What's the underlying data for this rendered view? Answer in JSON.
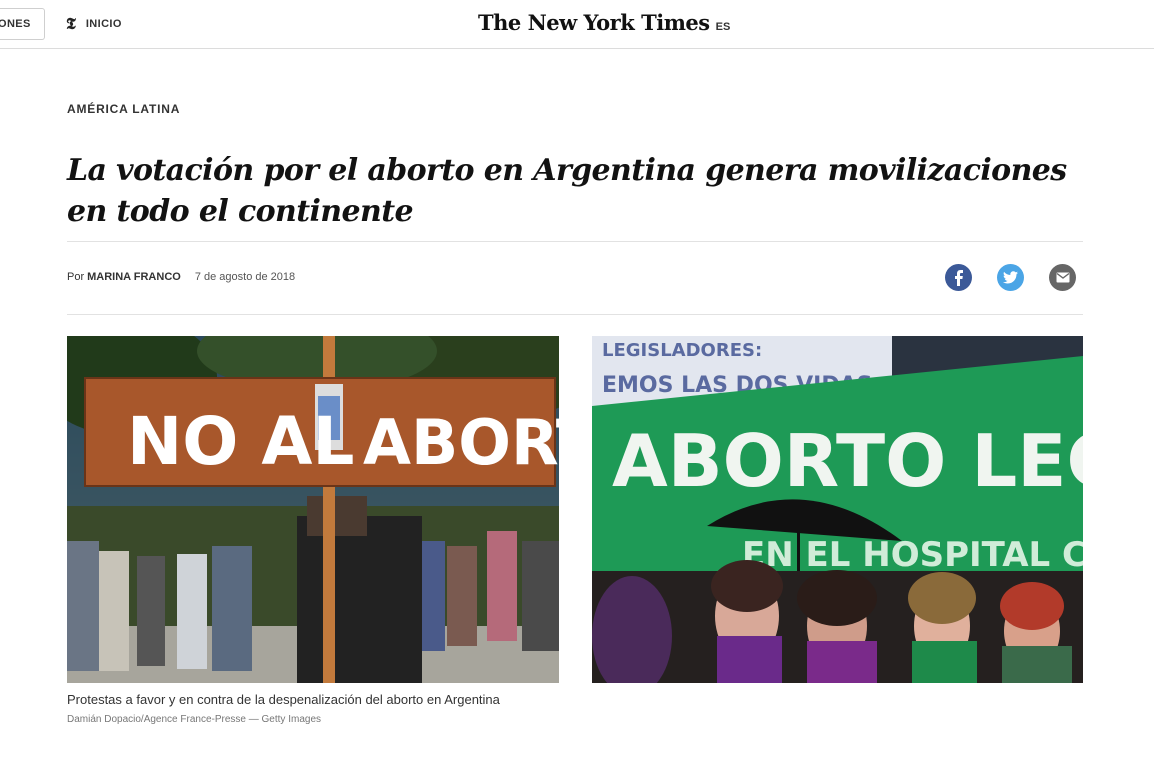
{
  "header": {
    "sections_label": "ONES",
    "home_label": "INICIO",
    "home_icon": "nyt-t-icon",
    "logo_text": "The New York Times",
    "lang_label": "ES"
  },
  "article": {
    "kicker": "AMÉRICA LATINA",
    "headline": "La votación por el aborto en Argentina genera movilizaciones en todo el continente",
    "byline_prefix": "Por",
    "author": "MARINA FRANCO",
    "date": "7 de agosto de 2018",
    "share": [
      "facebook-icon",
      "twitter-icon",
      "email-icon"
    ],
    "colors": {
      "facebook": "#3b5998",
      "twitter": "#4ba5e6",
      "email": "#666666"
    }
  },
  "images": {
    "left_sign_text": "NO AL ABORTO",
    "right_banner_top": "LEGISLADORES: SALVEMOS LAS DOS VIDAS",
    "right_banner_main": "ABORTO LEGAL",
    "right_banner_sub": "EN EL HOSPITAL CUANDO"
  },
  "caption": {
    "text": "Protestas a favor y en contra de la despenalización del aborto en Argentina",
    "credit": "Damián Dopacio/Agence France-Presse — Getty Images"
  }
}
